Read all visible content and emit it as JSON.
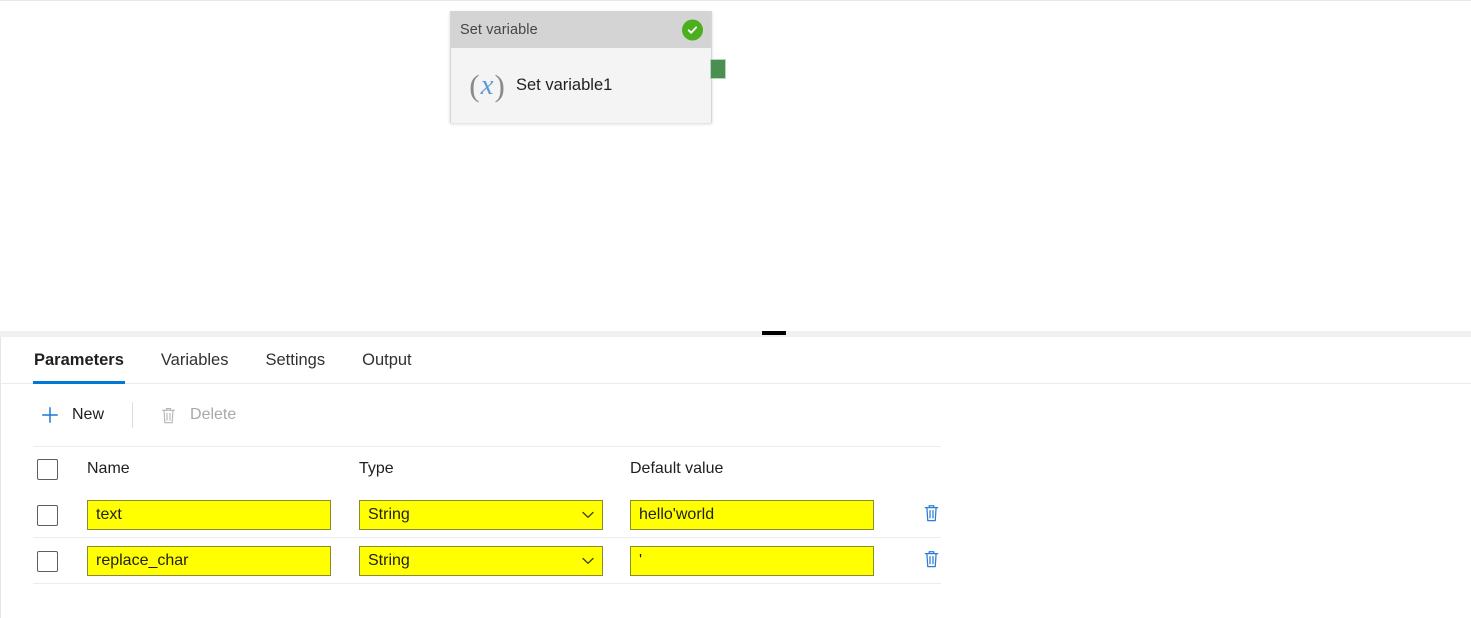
{
  "canvas": {
    "activity": {
      "header_title": "Set variable",
      "status_icon": "check-circle-icon",
      "status_color": "#4caf1d",
      "type_icon": "variable-x-icon",
      "icon_open_paren": "(",
      "icon_x": "x",
      "icon_close_paren": ")",
      "name": "Set variable1",
      "output_connector_color": "#4a8f52"
    }
  },
  "splitter": {
    "handle_icon": "drag-handle-icon"
  },
  "panel": {
    "tabs": [
      {
        "label": "Parameters",
        "active": true
      },
      {
        "label": "Variables",
        "active": false
      },
      {
        "label": "Settings",
        "active": false
      },
      {
        "label": "Output",
        "active": false
      }
    ],
    "accent_color": "#0078d4",
    "toolbar": {
      "new_label": "New",
      "new_icon": "plus-icon",
      "delete_label": "Delete",
      "delete_icon": "trash-icon",
      "delete_disabled": true
    },
    "table": {
      "columns": [
        "Name",
        "Type",
        "Default value"
      ],
      "select_all_checkbox": false,
      "highlight_color": "#ffff00",
      "rows": [
        {
          "selected": false,
          "name": "text",
          "type": "String",
          "default_value": "hello'world",
          "delete_icon": "trash-icon",
          "highlighted": true
        },
        {
          "selected": false,
          "name": "replace_char",
          "type": "String",
          "default_value": "'",
          "delete_icon": "trash-icon",
          "highlighted": true
        }
      ]
    }
  }
}
